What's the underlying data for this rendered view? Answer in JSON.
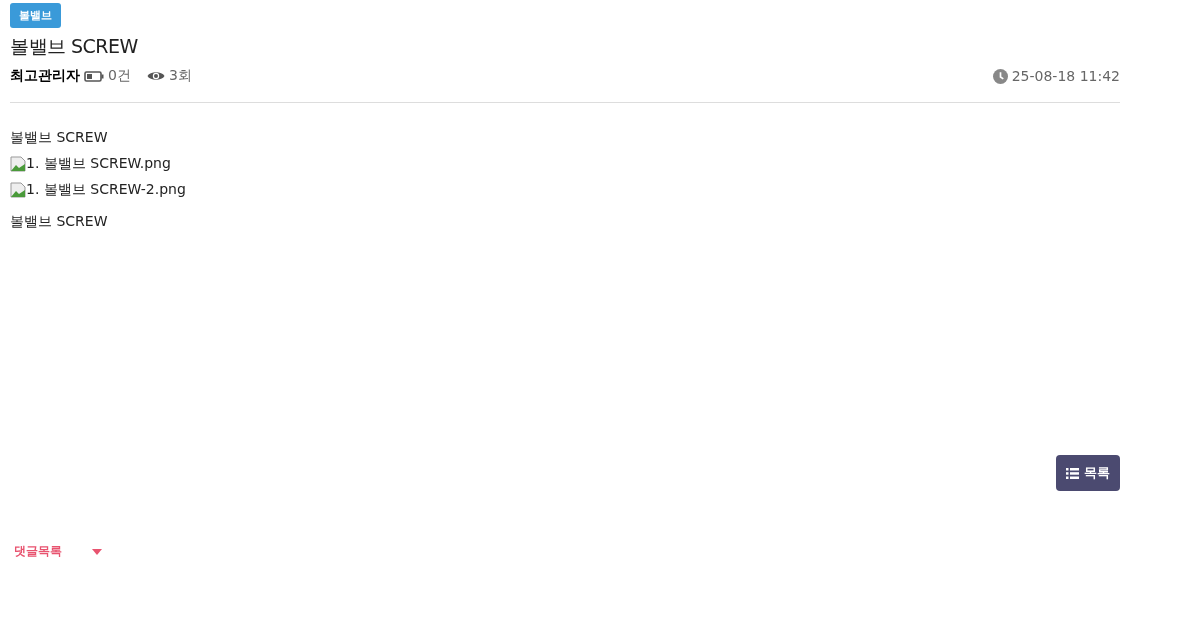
{
  "category": "볼밸브",
  "title": "볼밸브 SCREW",
  "meta": {
    "author": "최고관리자",
    "comments": "0건",
    "views": "3회",
    "datetime": "25-08-18 11:42"
  },
  "body": [
    {
      "kind": "text",
      "text": "볼밸브 SCREW"
    },
    {
      "kind": "image",
      "alt": "1. 볼밸브 SCREW.png"
    },
    {
      "kind": "image",
      "alt": "1. 볼밸브 SCREW-2.png"
    },
    {
      "kind": "paragraph",
      "text": "볼밸브 SCREW"
    }
  ],
  "list_button": "목록",
  "comments_toggle": {
    "label": "댓글목록",
    "expanded": false
  }
}
